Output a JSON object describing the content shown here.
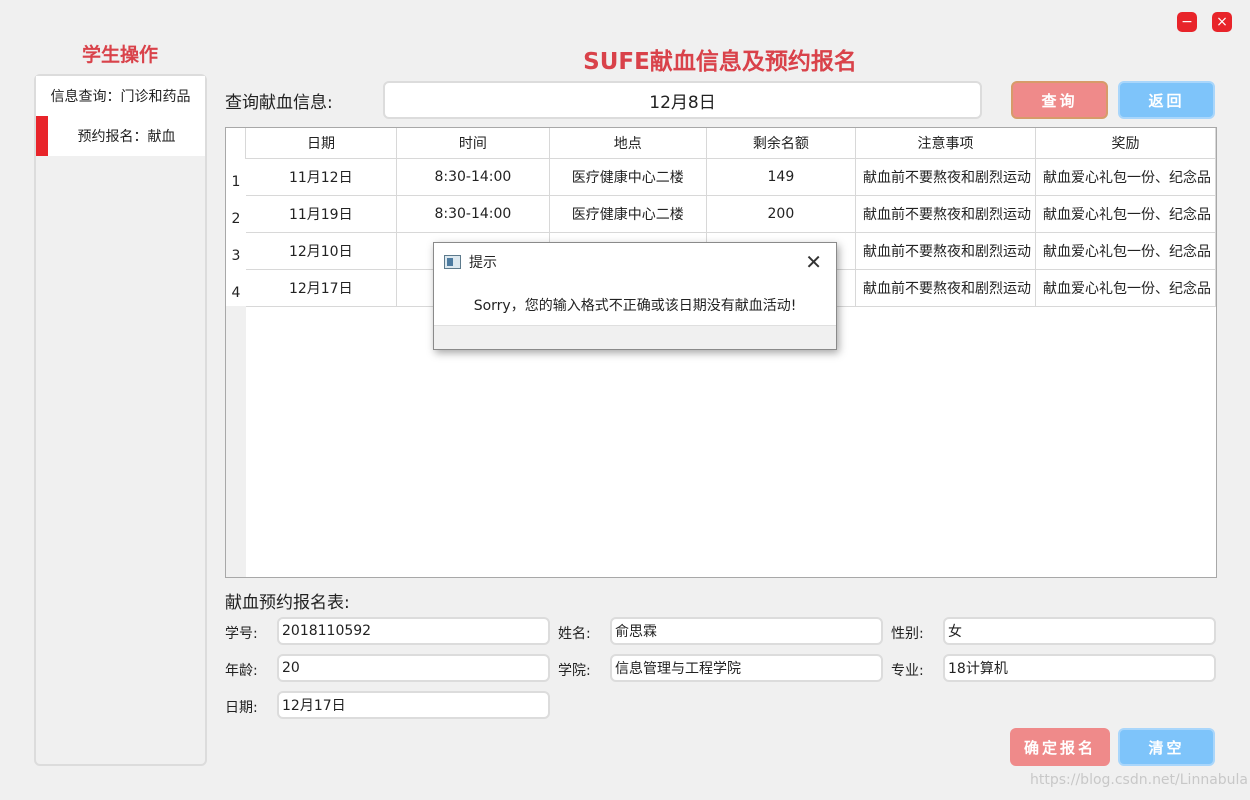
{
  "window": {
    "minimize_icon": "minimize-icon",
    "close_icon": "close-icon",
    "min_glyph": "−",
    "close_glyph": "×"
  },
  "sidebar": {
    "title": "学生操作",
    "items": [
      {
        "label": "信息查询：门诊和药品"
      },
      {
        "label": "预约报名：献血",
        "active": true
      }
    ]
  },
  "header": {
    "title": "SUFE献血信息及预约报名"
  },
  "query": {
    "label": "查询献血信息:",
    "value": "12月8日",
    "query_button": "查询",
    "back_button": "返回"
  },
  "table": {
    "columns": [
      "日期",
      "时间",
      "地点",
      "剩余名额",
      "注意事项",
      "奖励"
    ],
    "rows": [
      {
        "num": "1",
        "cells": [
          "11月12日",
          "8:30-14:00",
          "医疗健康中心二楼",
          "149",
          "献血前不要熬夜和剧烈运动",
          "献血爱心礼包一份、纪念品"
        ]
      },
      {
        "num": "2",
        "cells": [
          "11月19日",
          "8:30-14:00",
          "医疗健康中心二楼",
          "200",
          "献血前不要熬夜和剧烈运动",
          "献血爱心礼包一份、纪念品"
        ]
      },
      {
        "num": "3",
        "cells": [
          "12月10日",
          "",
          "",
          "",
          "献血前不要熬夜和剧烈运动",
          "献血爱心礼包一份、纪念品"
        ]
      },
      {
        "num": "4",
        "cells": [
          "12月17日",
          "",
          "",
          "",
          "献血前不要熬夜和剧烈运动",
          "献血爱心礼包一份、纪念品"
        ]
      }
    ]
  },
  "form": {
    "title": "献血预约报名表:",
    "fields": {
      "student_id": {
        "label": "学号:",
        "value": "2018110592"
      },
      "name": {
        "label": "姓名:",
        "value": "俞思霖"
      },
      "gender": {
        "label": "性别:",
        "value": "女"
      },
      "age": {
        "label": "年龄:",
        "value": "20"
      },
      "college": {
        "label": "学院:",
        "value": "信息管理与工程学院"
      },
      "major": {
        "label": "专业:",
        "value": "18计算机"
      },
      "date": {
        "label": "日期:",
        "value": "12月17日"
      }
    },
    "confirm_button": "确定报名",
    "clear_button": "清空"
  },
  "dialog": {
    "title": "提示",
    "message": "Sorry，您的输入格式不正确或该日期没有献血活动!",
    "close_glyph": "✕"
  },
  "watermark": "https://blog.csdn.net/Linnabula",
  "colors": {
    "accent_red": "#e8242a",
    "title_red": "#d9424a",
    "btn_red": "#ef8a8a",
    "btn_blue": "#7ec4fa"
  }
}
